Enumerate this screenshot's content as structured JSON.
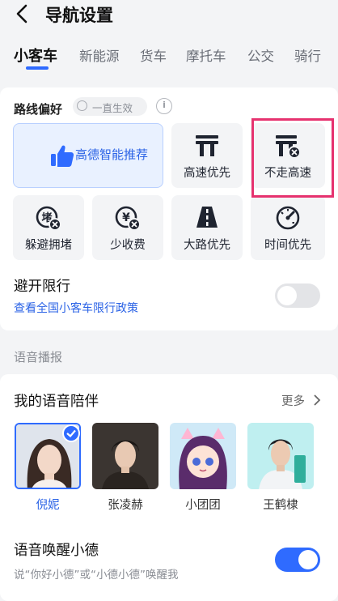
{
  "header": {
    "title": "导航设置"
  },
  "tabs": [
    {
      "label": "小客车"
    },
    {
      "label": "新能源"
    },
    {
      "label": "货车"
    },
    {
      "label": "摩托车"
    },
    {
      "label": "公交"
    },
    {
      "label": "骑行"
    }
  ],
  "route_pref": {
    "label": "路线偏好",
    "always_on_label": "一直生效",
    "info_icon": "i",
    "options": [
      {
        "label": "高德智能推荐",
        "icon": "thumbs-up-icon"
      },
      {
        "label": "高速优先",
        "icon": "highway-icon"
      },
      {
        "label": "不走高速",
        "icon": "no-highway-icon"
      },
      {
        "label": "躲避拥堵",
        "icon": "avoid-congestion-icon"
      },
      {
        "label": "少收费",
        "icon": "less-toll-icon"
      },
      {
        "label": "大路优先",
        "icon": "main-road-icon"
      },
      {
        "label": "时间优先",
        "icon": "speedometer-icon"
      }
    ],
    "selected": "高德智能推荐"
  },
  "avoid_restriction": {
    "title": "避开限行",
    "link": "查看全国小客车限行政策",
    "enabled": false
  },
  "voice_section": {
    "title": "语音播报"
  },
  "voice_companion": {
    "title": "我的语音陪伴",
    "more": "更多",
    "voices": [
      {
        "name": "倪妮",
        "selected": true
      },
      {
        "name": "张凌赫",
        "selected": false
      },
      {
        "name": "小团团",
        "selected": false
      },
      {
        "name": "王鹤棣",
        "selected": false
      }
    ]
  },
  "voice_wake": {
    "title": "语音唤醒小德",
    "desc": "说“你好小德”或“小德小德”唤醒我",
    "enabled": true
  },
  "colors": {
    "accent": "#2f6bff",
    "highlight": "#e6326f"
  }
}
